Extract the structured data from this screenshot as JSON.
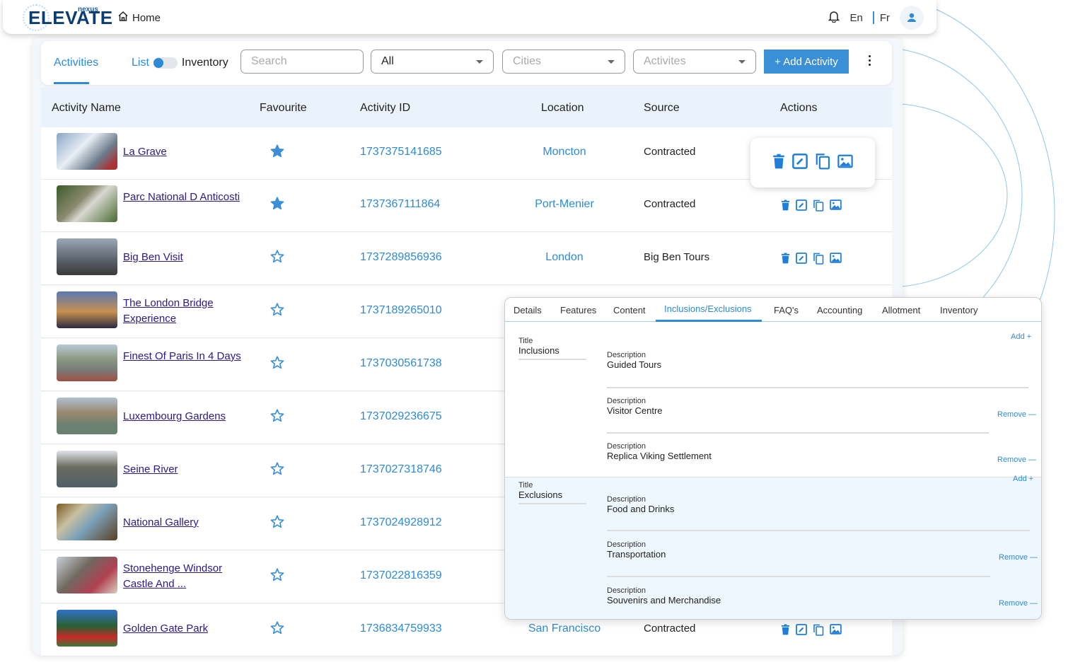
{
  "header": {
    "logo_text": "ELEVATE",
    "logo_sub": "nexus",
    "home_label": "Home",
    "lang_en": "En",
    "lang_fr": "Fr"
  },
  "filters": {
    "tab_label": "Activities",
    "toggle_left": "List",
    "toggle_right": "Inventory",
    "search_placeholder": "Search",
    "type_select": "All",
    "cities_placeholder": "Cities",
    "activities_placeholder": "Activites",
    "add_button": "+ Add Activity"
  },
  "table": {
    "columns": [
      "Activity Name",
      "Favourite",
      "Activity ID",
      "Location",
      "Source",
      "Actions"
    ],
    "rows": [
      {
        "name": "La Grave",
        "favourite": true,
        "id": "1737375141685",
        "location": "Moncton",
        "source": "Contracted"
      },
      {
        "name": "Parc National D Anticosti",
        "favourite": true,
        "id": "1737367111864",
        "location": "Port-Menier",
        "source": "Contracted"
      },
      {
        "name": "Big Ben Visit",
        "favourite": false,
        "id": "1737289856936",
        "location": "London",
        "source": "Big Ben Tours"
      },
      {
        "name": "The London Bridge Experience",
        "favourite": false,
        "id": "1737189265010",
        "location": "",
        "source": ""
      },
      {
        "name": "Finest Of Paris In 4 Days",
        "favourite": false,
        "id": "1737030561738",
        "location": "",
        "source": ""
      },
      {
        "name": "Luxembourg Gardens",
        "favourite": false,
        "id": "1737029236675",
        "location": "",
        "source": ""
      },
      {
        "name": "Seine River",
        "favourite": false,
        "id": "1737027318746",
        "location": "",
        "source": ""
      },
      {
        "name": "National Gallery",
        "favourite": false,
        "id": "1737024928912",
        "location": "",
        "source": ""
      },
      {
        "name": "Stonehenge Windsor Castle And ...",
        "favourite": false,
        "id": "1737022816359",
        "location": "",
        "source": ""
      },
      {
        "name": "Golden Gate Park",
        "favourite": false,
        "id": "1736834759933",
        "location": "San Francisco",
        "source": "Contracted"
      }
    ]
  },
  "detail": {
    "tabs": [
      "Details",
      "Features",
      "Content",
      "Inclusions/Exclusions",
      "FAQ's",
      "Accounting",
      "Allotment",
      "Inventory"
    ],
    "active_tab": "Inclusions/Exclusions",
    "title_label": "Title",
    "description_label": "Description",
    "add_label": "Add +",
    "remove_label": "Remove —",
    "inclusions": {
      "title": "Inclusions",
      "items": [
        "Guided Tours",
        "Visitor Centre",
        "Replica Viking Settlement"
      ]
    },
    "exclusions": {
      "title": "Exclusions",
      "items": [
        "Food and Drinks",
        "Transportation",
        "Souvenirs and Merchandise"
      ]
    }
  },
  "colors": {
    "accent": "#2d8ad8",
    "button": "#3a8fd6",
    "link": "#2a1a8a",
    "header_bg": "#eaf3fb",
    "exclusions_bg": "#eff7fe"
  }
}
